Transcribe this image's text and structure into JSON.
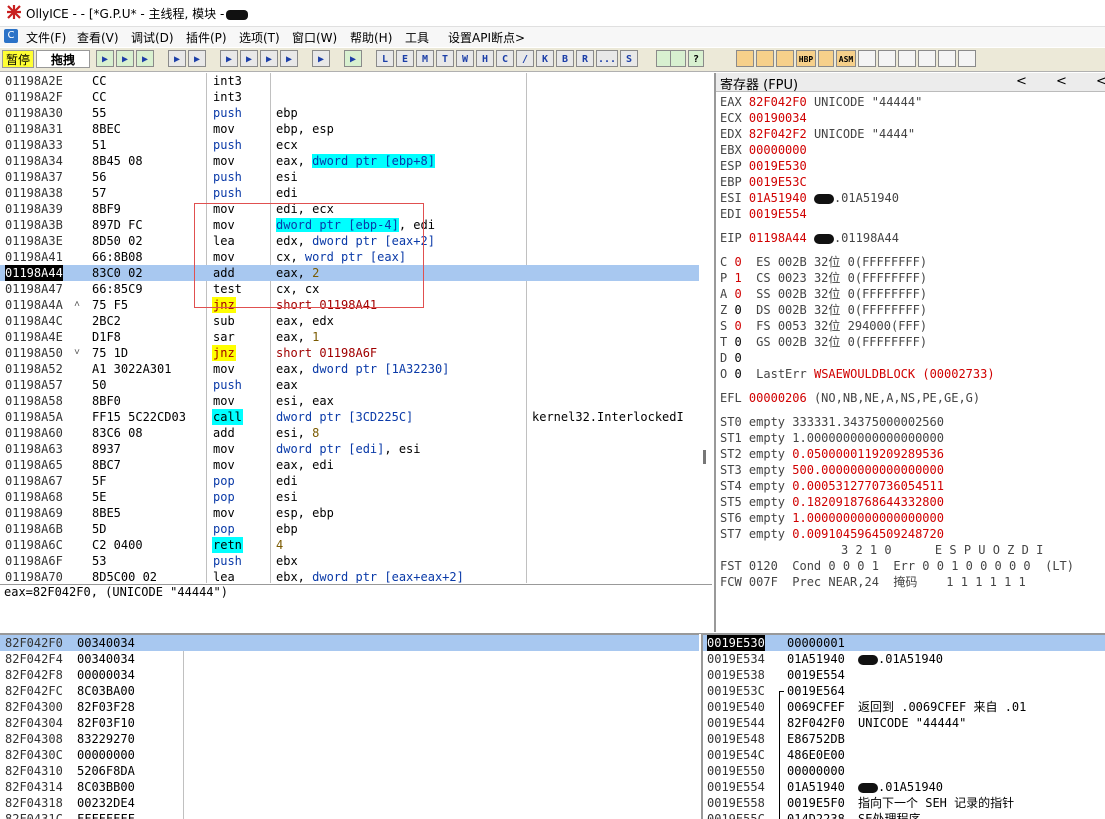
{
  "window": {
    "title": "OllyICE - - [*G.P.U* - 主线程, 模块 -",
    "title_redacted": "redacted"
  },
  "menu": {
    "items": [
      "文件(F)",
      "查看(V)",
      "调试(D)",
      "插件(P)",
      "选项(T)",
      "窗口(W)",
      "帮助(H)",
      "工具",
      "设置API断点>"
    ]
  },
  "toolbar": {
    "status": "暂停",
    "mode": "拖拽",
    "letters": [
      "L",
      "E",
      "M",
      "T",
      "W",
      "H",
      "C",
      "/",
      "K",
      "B",
      "R",
      "...",
      "S"
    ],
    "right_buttons": [
      "HBP",
      "ASM"
    ]
  },
  "disasm": {
    "rows": [
      {
        "addr": "01198A2E",
        "mark": "",
        "hex": "CC",
        "op": "int3",
        "args": "",
        "cmt": "",
        "optype": "normal"
      },
      {
        "addr": "01198A2F",
        "mark": "",
        "hex": "CC",
        "op": "int3",
        "args": "",
        "cmt": "",
        "optype": "normal"
      },
      {
        "addr": "01198A30",
        "mark": "",
        "hex": "55",
        "op": "push",
        "args": "ebp",
        "cmt": "",
        "optype": "push"
      },
      {
        "addr": "01198A31",
        "mark": "",
        "hex": "8BEC",
        "op": "mov",
        "args": "ebp, esp",
        "cmt": "",
        "optype": "normal"
      },
      {
        "addr": "01198A33",
        "mark": "",
        "hex": "51",
        "op": "push",
        "args": "ecx",
        "cmt": "",
        "optype": "push"
      },
      {
        "addr": "01198A34",
        "mark": "",
        "hex": "8B45 08",
        "op": "mov",
        "args_pre": "eax, ",
        "args_hl": "dword ptr [ebp+8]",
        "args_post": "",
        "cmt": "",
        "optype": "normal"
      },
      {
        "addr": "01198A37",
        "mark": "",
        "hex": "56",
        "op": "push",
        "args": "esi",
        "cmt": "",
        "optype": "push"
      },
      {
        "addr": "01198A38",
        "mark": "",
        "hex": "57",
        "op": "push",
        "args": "edi",
        "cmt": "",
        "optype": "push"
      },
      {
        "addr": "01198A39",
        "mark": "",
        "hex": "8BF9",
        "op": "mov",
        "args": "edi, ecx",
        "cmt": "",
        "optype": "normal"
      },
      {
        "addr": "01198A3B",
        "mark": "",
        "hex": "897D FC",
        "op": "mov",
        "args_pre": "",
        "args_hl": "dword ptr [ebp-4]",
        "args_post": ", edi",
        "cmt": "",
        "optype": "normal"
      },
      {
        "addr": "01198A3E",
        "mark": "",
        "hex": "8D50 02",
        "op": "lea",
        "args_pre": "edx, ",
        "args_mem": "dword ptr [eax+2]",
        "cmt": "",
        "optype": "normal"
      },
      {
        "addr": "01198A41",
        "mark": "",
        "hex": "66:8B08",
        "op": "mov",
        "args_pre": "cx, ",
        "args_mem": "word ptr [eax]",
        "cmt": "",
        "optype": "normal"
      },
      {
        "addr": "01198A44",
        "mark": "",
        "hex": "83C0 02",
        "op": "add",
        "args_pre": "eax, ",
        "args_num": "2",
        "cmt": "",
        "optype": "normal",
        "selected": true
      },
      {
        "addr": "01198A47",
        "mark": "",
        "hex": "66:85C9",
        "op": "test",
        "args": "cx, cx",
        "cmt": "",
        "optype": "normal"
      },
      {
        "addr": "01198A4A",
        "mark": "^",
        "hex": "75 F5",
        "op": "jnz",
        "args_jmp": "short 01198A41",
        "cmt": "",
        "optype": "jcc"
      },
      {
        "addr": "01198A4C",
        "mark": "",
        "hex": "2BC2",
        "op": "sub",
        "args": "eax, edx",
        "cmt": "",
        "optype": "normal"
      },
      {
        "addr": "01198A4E",
        "mark": "",
        "hex": "D1F8",
        "op": "sar",
        "args_pre": "eax, ",
        "args_num": "1",
        "cmt": "",
        "optype": "normal"
      },
      {
        "addr": "01198A50",
        "mark": "v",
        "hex": "75 1D",
        "op": "jnz",
        "args_jmp": "short 01198A6F",
        "cmt": "",
        "optype": "jcc"
      },
      {
        "addr": "01198A52",
        "mark": "",
        "hex": "A1 3022A301",
        "op": "mov",
        "args_pre": "eax, ",
        "args_mem": "dword ptr [1A32230]",
        "cmt": "",
        "optype": "normal"
      },
      {
        "addr": "01198A57",
        "mark": "",
        "hex": "50",
        "op": "push",
        "args": "eax",
        "cmt": "",
        "optype": "push"
      },
      {
        "addr": "01198A58",
        "mark": "",
        "hex": "8BF0",
        "op": "mov",
        "args": "esi, eax",
        "cmt": "",
        "optype": "normal"
      },
      {
        "addr": "01198A5A",
        "mark": "",
        "hex": "FF15 5C22CD03",
        "op": "call",
        "args_mem": "dword ptr [3CD225C]",
        "cmt": "kernel32.InterlockedI",
        "optype": "call"
      },
      {
        "addr": "01198A60",
        "mark": "",
        "hex": "83C6 08",
        "op": "add",
        "args_pre": "esi, ",
        "args_num": "8",
        "cmt": "",
        "optype": "normal"
      },
      {
        "addr": "01198A63",
        "mark": "",
        "hex": "8937",
        "op": "mov",
        "args_mem": "dword ptr [edi]",
        "args_post": ", esi",
        "cmt": "",
        "optype": "normal"
      },
      {
        "addr": "01198A65",
        "mark": "",
        "hex": "8BC7",
        "op": "mov",
        "args": "eax, edi",
        "cmt": "",
        "optype": "normal"
      },
      {
        "addr": "01198A67",
        "mark": "",
        "hex": "5F",
        "op": "pop",
        "args": "edi",
        "cmt": "",
        "optype": "pop"
      },
      {
        "addr": "01198A68",
        "mark": "",
        "hex": "5E",
        "op": "pop",
        "args": "esi",
        "cmt": "",
        "optype": "pop"
      },
      {
        "addr": "01198A69",
        "mark": "",
        "hex": "8BE5",
        "op": "mov",
        "args": "esp, ebp",
        "cmt": "",
        "optype": "normal"
      },
      {
        "addr": "01198A6B",
        "mark": "",
        "hex": "5D",
        "op": "pop",
        "args": "ebp",
        "cmt": "",
        "optype": "pop"
      },
      {
        "addr": "01198A6C",
        "mark": "",
        "hex": "C2 0400",
        "op": "retn",
        "args_num": "4",
        "cmt": "",
        "optype": "retn"
      },
      {
        "addr": "01198A6F",
        "mark": "",
        "hex": "53",
        "op": "push",
        "args": "ebx",
        "cmt": "",
        "optype": "push"
      },
      {
        "addr": "01198A70",
        "mark": "",
        "hex": "8D5C00 02",
        "op": "lea",
        "args_pre": "ebx, ",
        "args_mem": "dword ptr [eax+eax+2]",
        "cmt": "",
        "optype": "normal"
      }
    ]
  },
  "info_line": "eax=82F042F0, (UNICODE \"44444\")",
  "registers": {
    "header": "寄存器 (FPU)",
    "nav": [
      "<",
      "<",
      "<"
    ],
    "rows": [
      {
        "name": "EAX",
        "val": "82F042F0",
        "red": true,
        "rest": "UNICODE \"44444\""
      },
      {
        "name": "ECX",
        "val": "00190034",
        "red": true,
        "rest": ""
      },
      {
        "name": "EDX",
        "val": "82F042F2",
        "red": true,
        "rest": "UNICODE \"4444\""
      },
      {
        "name": "EBX",
        "val": "00000000",
        "red": true,
        "rest": ""
      },
      {
        "name": "ESP",
        "val": "0019E530",
        "red": true,
        "rest": ""
      },
      {
        "name": "EBP",
        "val": "0019E53C",
        "red": true,
        "rest": ""
      },
      {
        "name": "ESI",
        "val": "01A51940",
        "red": true,
        "rest": ".01A51940",
        "blob": true
      },
      {
        "name": "EDI",
        "val": "0019E554",
        "red": true,
        "rest": ""
      },
      {
        "name": "EIP",
        "val": "01198A44",
        "red": true,
        "rest": ".01198A44",
        "blob": true,
        "gap": true
      },
      {
        "flag": "C",
        "bit": "0",
        "red": true,
        "seg": "ES 002B 32位 0(FFFFFFFF)"
      },
      {
        "flag": "P",
        "bit": "1",
        "red": true,
        "seg": "CS 0023 32位 0(FFFFFFFF)"
      },
      {
        "flag": "A",
        "bit": "0",
        "red": true,
        "seg": "SS 002B 32位 0(FFFFFFFF)"
      },
      {
        "flag": "Z",
        "bit": "0",
        "red": false,
        "seg": "DS 002B 32位 0(FFFFFFFF)"
      },
      {
        "flag": "S",
        "bit": "0",
        "red": true,
        "seg": "FS 0053 32位 294000(FFF)"
      },
      {
        "flag": "T",
        "bit": "0",
        "red": false,
        "seg": "GS 002B 32位 0(FFFFFFFF)"
      },
      {
        "flag": "D",
        "bit": "0",
        "red": false,
        "seg": ""
      },
      {
        "flag": "O",
        "bit": "0",
        "red": false,
        "seg": "LastErr",
        "lasterr": "WSAEWOULDBLOCK (00002733)"
      }
    ],
    "efl": {
      "name": "EFL",
      "val": "00000206",
      "rest": "(NO,NB,NE,A,NS,PE,GE,G)"
    },
    "fpu": [
      {
        "name": "ST0 empty",
        "val": "333331.34375000002560",
        "red": false
      },
      {
        "name": "ST1 empty",
        "val": "1.0000000000000000000",
        "red": false
      },
      {
        "name": "ST2 empty",
        "val": "0.0500000119209289536",
        "red": true
      },
      {
        "name": "ST3 empty",
        "val": "500.00000000000000000",
        "red": true
      },
      {
        "name": "ST4 empty",
        "val": "0.0005312770736054511",
        "red": true
      },
      {
        "name": "ST5 empty",
        "val": "0.1820918768644332800",
        "red": true
      },
      {
        "name": "ST6 empty",
        "val": "1.0000000000000000000",
        "red": true
      },
      {
        "name": "ST7 empty",
        "val": "0.0091045964509248720",
        "red": true
      }
    ],
    "fpu_header": "3 2 1 0      E S P U O Z D I",
    "fst": "FST 0120  Cond 0 0 0 1  Err 0 0 1 0 0 0 0 0  (LT)",
    "fcw": "FCW 007F  Prec NEAR,24  掩码    1 1 1 1 1 1"
  },
  "dump": {
    "rows": [
      {
        "addr": "82F042F0",
        "val": "00340034",
        "sel": true
      },
      {
        "addr": "82F042F4",
        "val": "00340034"
      },
      {
        "addr": "82F042F8",
        "val": "00000034"
      },
      {
        "addr": "82F042FC",
        "val": "8C03BA00"
      },
      {
        "addr": "82F04300",
        "val": "82F03F28"
      },
      {
        "addr": "82F04304",
        "val": "82F03F10"
      },
      {
        "addr": "82F04308",
        "val": "83229270"
      },
      {
        "addr": "82F0430C",
        "val": "00000000"
      },
      {
        "addr": "82F04310",
        "val": "5206F8DA"
      },
      {
        "addr": "82F04314",
        "val": "8C03BB00"
      },
      {
        "addr": "82F04318",
        "val": "00232DE4"
      },
      {
        "addr": "82F0431C",
        "val": "FFFFFFFF"
      }
    ]
  },
  "stack": {
    "rows": [
      {
        "addr": "0019E530",
        "val": "00000001",
        "cmt": "",
        "cur": true,
        "sel": true
      },
      {
        "addr": "0019E534",
        "val": "01A51940",
        "cmt": ".01A51940",
        "blob": true
      },
      {
        "addr": "0019E538",
        "val": "0019E554",
        "cmt": ""
      },
      {
        "addr": "0019E53C",
        "val": "0019E564",
        "cmt": "",
        "frame": true
      },
      {
        "addr": "0019E540",
        "val": "0069CFEF",
        "cmt": "返回到 .0069CFEF 来自 .01"
      },
      {
        "addr": "0019E544",
        "val": "82F042F0",
        "cmt": "UNICODE \"44444\""
      },
      {
        "addr": "0019E548",
        "val": "E86752DB",
        "cmt": ""
      },
      {
        "addr": "0019E54C",
        "val": "486E0E00",
        "cmt": ""
      },
      {
        "addr": "0019E550",
        "val": "00000000",
        "cmt": ""
      },
      {
        "addr": "0019E554",
        "val": "01A51940",
        "cmt": ".01A51940",
        "blob": true
      },
      {
        "addr": "0019E558",
        "val": "0019E5F0",
        "cmt": "指向下一个 SEH 记录的指针"
      },
      {
        "addr": "0019E55C",
        "val": "014D2238",
        "cmt": "SE处理程序"
      }
    ]
  }
}
